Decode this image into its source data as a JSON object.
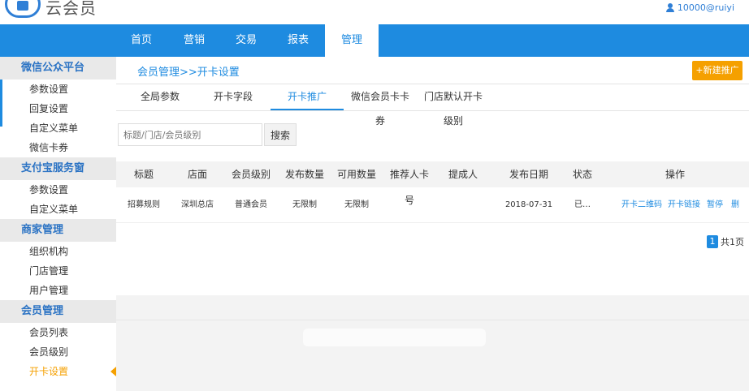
{
  "brand": {
    "name": "云会员"
  },
  "user": {
    "account": "10000@ruiyi"
  },
  "nav": {
    "items": [
      {
        "label": "首页"
      },
      {
        "label": "营销"
      },
      {
        "label": "交易"
      },
      {
        "label": "报表"
      },
      {
        "label": "管理",
        "active": true
      }
    ]
  },
  "sidebar": {
    "groups": [
      {
        "title": "微信公众平台",
        "items": [
          "参数设置",
          "回复设置",
          "自定义菜单",
          "微信卡券"
        ]
      },
      {
        "title": "支付宝服务窗",
        "items": [
          "参数设置",
          "自定义菜单"
        ]
      },
      {
        "title": "商家管理",
        "items": [
          "组织机构",
          "门店管理",
          "用户管理"
        ]
      },
      {
        "title": "会员管理",
        "items": [
          "会员列表",
          "会员级别",
          "开卡设置"
        ]
      }
    ],
    "active_item": "开卡设置"
  },
  "breadcrumb": {
    "text": "会员管理>>开卡设置"
  },
  "new_button": {
    "label": "+新建推广"
  },
  "tabs": [
    "全局参数",
    "开卡字段",
    "开卡推广",
    "微信会员卡卡券",
    "门店默认开卡级别"
  ],
  "active_tab": "开卡推广",
  "search": {
    "placeholder": "标题/门店/会员级别",
    "button": "搜索"
  },
  "table": {
    "headers": [
      "标题",
      "店面",
      "会员级别",
      "发布数量",
      "可用数量",
      "推荐人卡号",
      "提成人",
      "发布日期",
      "状态",
      "操作"
    ],
    "rows": [
      {
        "title": "招募规则",
        "store": "深圳总店",
        "level": "普通会员",
        "publish_qty": "无限制",
        "available_qty": "无限制",
        "referrer_card": "",
        "commission_person": "",
        "date": "2018-07-31",
        "status": "已…",
        "ops": [
          "开卡二维码",
          "开卡链接",
          "暂停",
          "删"
        ]
      }
    ]
  },
  "pager": {
    "page": "1",
    "total": "共1页"
  },
  "colors": {
    "primary": "#1e8be0",
    "accent": "#f5a000",
    "group_text": "#2b73c4"
  }
}
